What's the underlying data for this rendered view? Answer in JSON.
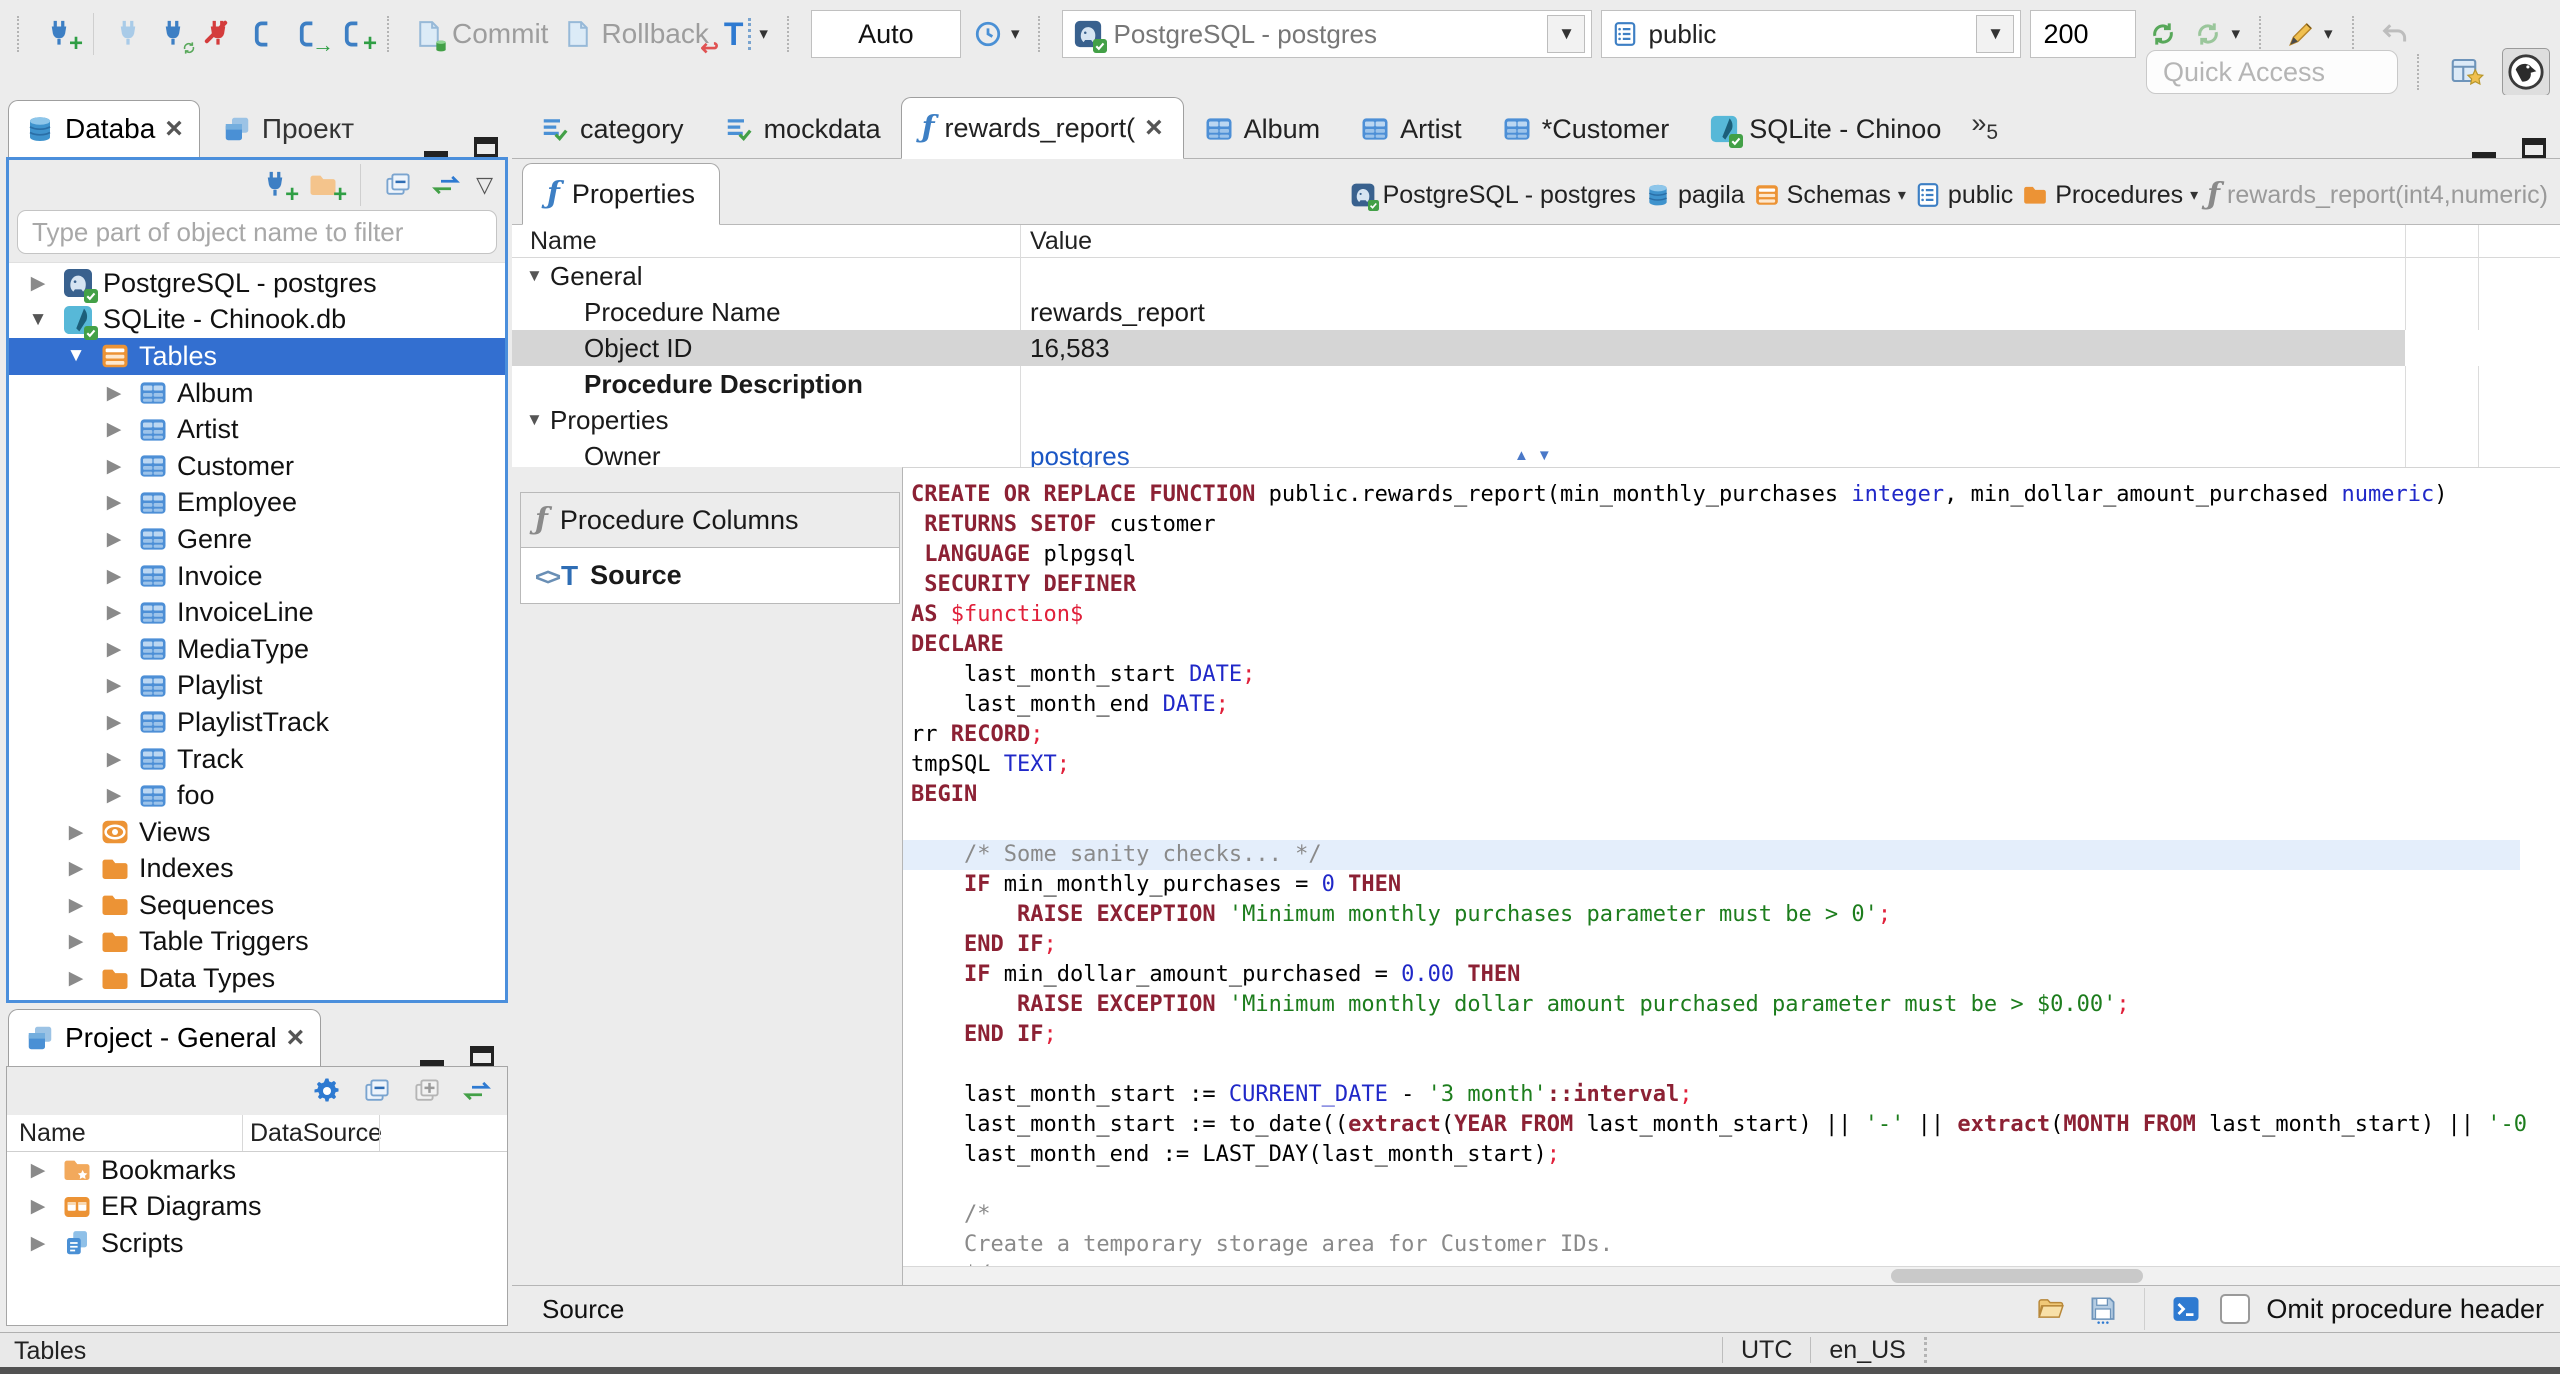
{
  "toolbar": {
    "commit_label": "Commit",
    "rollback_label": "Rollback",
    "transaction_mode_icon": "T",
    "auto_commit_mode": "Auto",
    "connection_selector": "PostgreSQL - postgres",
    "schema_selector": "public",
    "fetch_size": "200",
    "quick_access_placeholder": "Quick Access"
  },
  "colors": {
    "tree_selection": "#336fd0",
    "focus_border": "#4b8fdc",
    "link": "#1a56c4",
    "code_keyword": "#8c2134",
    "code_type_number": "#2028c8",
    "code_string": "#1d7d1d",
    "code_comment": "#8a8a8a",
    "code_delimiter": "#e0203a",
    "current_line": "#e4eefb"
  },
  "sidebar": {
    "tabs": [
      {
        "label": "Databa"
      },
      {
        "label": "Проект"
      }
    ],
    "filter_placeholder": "Type part of object name to filter",
    "tree": [
      {
        "label": "PostgreSQL - postgres"
      },
      {
        "label": "SQLite - Chinook.db"
      },
      {
        "label": "Tables"
      },
      {
        "label": "Album"
      },
      {
        "label": "Artist"
      },
      {
        "label": "Customer"
      },
      {
        "label": "Employee"
      },
      {
        "label": "Genre"
      },
      {
        "label": "Invoice"
      },
      {
        "label": "InvoiceLine"
      },
      {
        "label": "MediaType"
      },
      {
        "label": "Playlist"
      },
      {
        "label": "PlaylistTrack"
      },
      {
        "label": "Track"
      },
      {
        "label": "foo"
      },
      {
        "label": "Views"
      },
      {
        "label": "Indexes"
      },
      {
        "label": "Sequences"
      },
      {
        "label": "Table Triggers"
      },
      {
        "label": "Data Types"
      }
    ]
  },
  "project_panel": {
    "title": "Project - General",
    "columns": {
      "name": "Name",
      "datasource": "DataSource"
    },
    "items": [
      {
        "label": "Bookmarks"
      },
      {
        "label": "ER Diagrams"
      },
      {
        "label": "Scripts"
      }
    ]
  },
  "editor": {
    "tabs": [
      {
        "label": "category"
      },
      {
        "label": "mockdata"
      },
      {
        "label": "rewards_report("
      },
      {
        "label": "Album"
      },
      {
        "label": "Artist"
      },
      {
        "label": "*Customer"
      },
      {
        "label": "SQLite - Chinoo"
      }
    ],
    "more_tabs_count": "5",
    "properties_tab_label": "Properties",
    "breadcrumb": [
      {
        "label": "PostgreSQL - postgres"
      },
      {
        "label": "pagila"
      },
      {
        "label": "Schemas"
      },
      {
        "label": "public"
      },
      {
        "label": "Procedures"
      },
      {
        "label": "rewards_report(int4,numeric)"
      }
    ],
    "props": {
      "name_col": "Name",
      "value_col": "Value",
      "rows": [
        {
          "name": "General",
          "value": ""
        },
        {
          "name": "Procedure Name",
          "value": "rewards_report"
        },
        {
          "name": "Object ID",
          "value": "16,583"
        },
        {
          "name": "Procedure Description",
          "value": ""
        },
        {
          "name": "Properties",
          "value": ""
        },
        {
          "name": "Owner",
          "value": "postgres"
        }
      ]
    },
    "pages": [
      {
        "label": "Procedure Columns"
      },
      {
        "label": "Source"
      }
    ],
    "bottom_tab_label": "Source",
    "omit_header_label": "Omit procedure header"
  },
  "source_code": {
    "lines": [
      {
        "t": [
          [
            "kw",
            "CREATE OR REPLACE FUNCTION"
          ],
          [
            "pl",
            " public.rewards_report(min_monthly_purchases "
          ],
          [
            "typ",
            "integer"
          ],
          [
            "pl",
            ", min_dollar_amount_purchased "
          ],
          [
            "typ",
            "numeric"
          ],
          [
            "pl",
            ")"
          ]
        ]
      },
      {
        "t": [
          [
            "pl",
            " "
          ],
          [
            "kw",
            "RETURNS SETOF"
          ],
          [
            "pl",
            " customer"
          ]
        ]
      },
      {
        "t": [
          [
            "pl",
            " "
          ],
          [
            "kw",
            "LANGUAGE"
          ],
          [
            "pl",
            " plpgsql"
          ]
        ]
      },
      {
        "t": [
          [
            "pl",
            " "
          ],
          [
            "kw",
            "SECURITY DEFINER"
          ]
        ]
      },
      {
        "t": [
          [
            "kw",
            "AS"
          ],
          [
            "red",
            " $function$"
          ]
        ]
      },
      {
        "t": [
          [
            "kw",
            "DECLARE"
          ]
        ]
      },
      {
        "t": [
          [
            "pl",
            "    last_month_start "
          ],
          [
            "typ",
            "DATE"
          ],
          [
            "red",
            ";"
          ]
        ]
      },
      {
        "t": [
          [
            "pl",
            "    last_month_end "
          ],
          [
            "typ",
            "DATE"
          ],
          [
            "red",
            ";"
          ]
        ]
      },
      {
        "t": [
          [
            "pl",
            "rr "
          ],
          [
            "kw",
            "RECORD"
          ],
          [
            "red",
            ";"
          ]
        ]
      },
      {
        "t": [
          [
            "pl",
            "tmpSQL "
          ],
          [
            "typ",
            "TEXT"
          ],
          [
            "red",
            ";"
          ]
        ]
      },
      {
        "t": [
          [
            "kw",
            "BEGIN"
          ]
        ]
      },
      {
        "t": []
      },
      {
        "t": [
          [
            "com",
            "    /* Some sanity checks... */"
          ]
        ],
        "hl": true
      },
      {
        "t": [
          [
            "pl",
            "    "
          ],
          [
            "kw",
            "IF"
          ],
          [
            "pl",
            " min_monthly_purchases = "
          ],
          [
            "num",
            "0"
          ],
          [
            "pl",
            " "
          ],
          [
            "kw",
            "THEN"
          ]
        ]
      },
      {
        "t": [
          [
            "pl",
            "        "
          ],
          [
            "kw",
            "RAISE EXCEPTION"
          ],
          [
            "pl",
            " "
          ],
          [
            "str",
            "'Minimum monthly purchases parameter must be > 0'"
          ],
          [
            "red",
            ";"
          ]
        ]
      },
      {
        "t": [
          [
            "pl",
            "    "
          ],
          [
            "kw",
            "END IF"
          ],
          [
            "red",
            ";"
          ]
        ]
      },
      {
        "t": [
          [
            "pl",
            "    "
          ],
          [
            "kw",
            "IF"
          ],
          [
            "pl",
            " min_dollar_amount_purchased = "
          ],
          [
            "num",
            "0.00"
          ],
          [
            "pl",
            " "
          ],
          [
            "kw",
            "THEN"
          ]
        ]
      },
      {
        "t": [
          [
            "pl",
            "        "
          ],
          [
            "kw",
            "RAISE EXCEPTION"
          ],
          [
            "pl",
            " "
          ],
          [
            "str",
            "'Minimum monthly dollar amount purchased parameter must be > $0.00'"
          ],
          [
            "red",
            ";"
          ]
        ]
      },
      {
        "t": [
          [
            "pl",
            "    "
          ],
          [
            "kw",
            "END IF"
          ],
          [
            "red",
            ";"
          ]
        ]
      },
      {
        "t": []
      },
      {
        "t": [
          [
            "pl",
            "    last_month_start := "
          ],
          [
            "typ",
            "CURRENT_DATE"
          ],
          [
            "pl",
            " - "
          ],
          [
            "str",
            "'3 month'"
          ],
          [
            "kw",
            "::interval"
          ],
          [
            "red",
            ";"
          ]
        ]
      },
      {
        "t": [
          [
            "pl",
            "    last_month_start := to_date(("
          ],
          [
            "kw",
            "extract"
          ],
          [
            "pl",
            "("
          ],
          [
            "kw",
            "YEAR FROM"
          ],
          [
            "pl",
            " last_month_start) || "
          ],
          [
            "str",
            "'-'"
          ],
          [
            "pl",
            " || "
          ],
          [
            "kw",
            "extract"
          ],
          [
            "pl",
            "("
          ],
          [
            "kw",
            "MONTH FROM"
          ],
          [
            "pl",
            " last_month_start) || "
          ],
          [
            "str",
            "'-0"
          ]
        ]
      },
      {
        "t": [
          [
            "pl",
            "    last_month_end := LAST_DAY(last_month_start)"
          ],
          [
            "red",
            ";"
          ]
        ]
      },
      {
        "t": []
      },
      {
        "t": [
          [
            "com",
            "    /*"
          ]
        ]
      },
      {
        "t": [
          [
            "com",
            "    Create a temporary storage area for Customer IDs."
          ]
        ]
      },
      {
        "t": [
          [
            "com",
            "    */"
          ]
        ]
      }
    ]
  },
  "statusbar": {
    "left": "Tables",
    "timezone": "UTC",
    "locale": "en_US"
  }
}
